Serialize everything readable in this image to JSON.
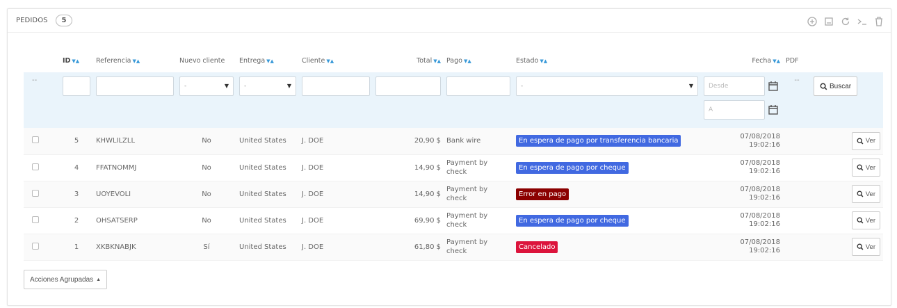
{
  "panel": {
    "title": "Pedidos",
    "count": "5"
  },
  "columns": {
    "id": "ID",
    "referencia": "Referencia",
    "nuevo_cliente": "Nuevo cliente",
    "entrega": "Entrega",
    "cliente": "Cliente",
    "total": "Total",
    "pago": "Pago",
    "estado": "Estado",
    "fecha": "Fecha",
    "pdf": "PDF"
  },
  "filters": {
    "dash": "--",
    "select_default": "-",
    "date_from_placeholder": "Desde",
    "date_to_placeholder": "A",
    "search_label": "Buscar"
  },
  "rows": [
    {
      "id": "5",
      "ref": "KHWLILZLL",
      "new": "No",
      "delivery": "United States",
      "customer": "J. DOE",
      "total": "20,90 $",
      "payment": "Bank wire",
      "status": "En espera de pago por transferencia bancaria",
      "status_color": "#4169E1",
      "date": "07/08/2018",
      "time": "19:02:16"
    },
    {
      "id": "4",
      "ref": "FFATNOMMJ",
      "new": "No",
      "delivery": "United States",
      "customer": "J. DOE",
      "total": "14,90 $",
      "payment": "Payment by check",
      "status": "En espera de pago por cheque",
      "status_color": "#4169E1",
      "date": "07/08/2018",
      "time": "19:02:16"
    },
    {
      "id": "3",
      "ref": "UOYEVOLI",
      "new": "No",
      "delivery": "United States",
      "customer": "J. DOE",
      "total": "14,90 $",
      "payment": "Payment by check",
      "status": "Error en pago",
      "status_color": "#8B0000",
      "date": "07/08/2018",
      "time": "19:02:16"
    },
    {
      "id": "2",
      "ref": "OHSATSERP",
      "new": "No",
      "delivery": "United States",
      "customer": "J. DOE",
      "total": "69,90 $",
      "payment": "Payment by check",
      "status": "En espera de pago por cheque",
      "status_color": "#4169E1",
      "date": "07/08/2018",
      "time": "19:02:16"
    },
    {
      "id": "1",
      "ref": "XKBKNABJK",
      "new": "Sí",
      "delivery": "United States",
      "customer": "J. DOE",
      "total": "61,80 $",
      "payment": "Payment by check",
      "status": "Cancelado",
      "status_color": "#DC143C",
      "date": "07/08/2018",
      "time": "19:02:16"
    }
  ],
  "row_action_label": "Ver",
  "bulk_actions_label": "Acciones Agrupadas"
}
